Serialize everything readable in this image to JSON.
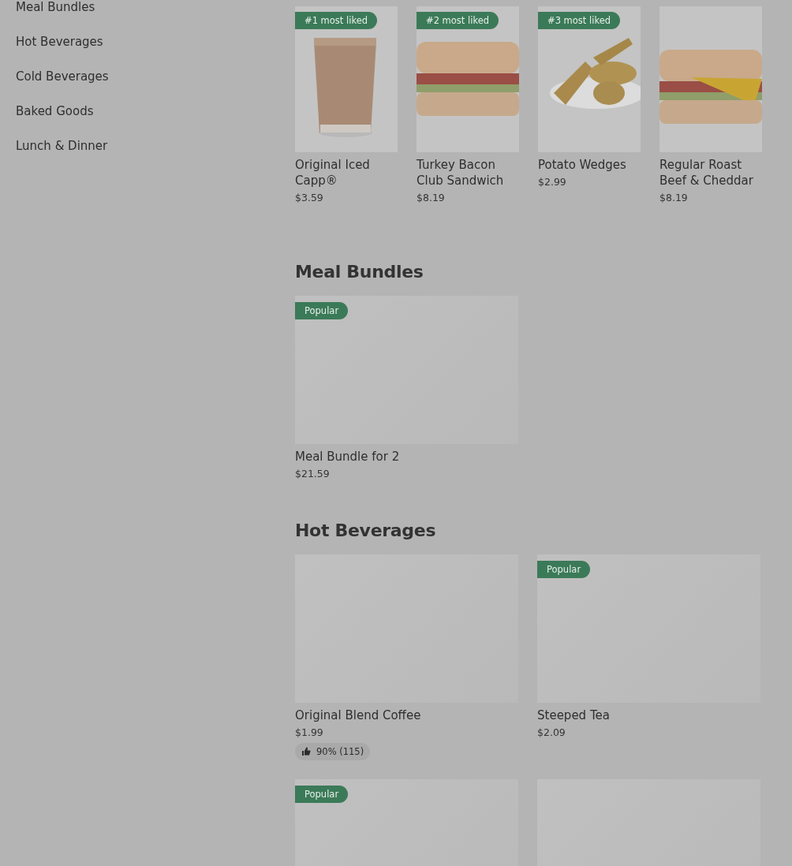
{
  "sidebar": {
    "items": [
      {
        "label": "Meal Bundles"
      },
      {
        "label": "Hot Beverages"
      },
      {
        "label": "Cold Beverages"
      },
      {
        "label": "Baked Goods"
      },
      {
        "label": "Lunch & Dinner"
      }
    ]
  },
  "most_liked": [
    {
      "kind": "picture",
      "badge": "#1 most liked",
      "name": "Original Iced Capp®",
      "price": "$3.59"
    },
    {
      "kind": "picture",
      "badge": "#2 most liked",
      "name": "Turkey Bacon Club Sandwich",
      "price": "$8.19"
    },
    {
      "kind": "picture",
      "badge": "#3 most liked",
      "name": "Potato Wedges",
      "price": "$2.99"
    },
    {
      "kind": "picture",
      "name": "Regular Roast Beef & Cheddar",
      "price": "$8.19"
    }
  ],
  "sections": [
    {
      "title": "Meal Bundles",
      "items": [
        {
          "kind": "placeholder",
          "badge": "Popular",
          "name": "Meal Bundle for 2",
          "price": "$21.59"
        }
      ]
    },
    {
      "title": "Hot Beverages",
      "items": [
        {
          "kind": "placeholder",
          "name": "Original Blend Coffee",
          "price": "$1.99",
          "rating": "90% (115)"
        },
        {
          "kind": "placeholder",
          "badge": "Popular",
          "name": "Steeped Tea",
          "price": "$2.09"
        },
        {
          "kind": "placeholder",
          "badge": "Popular"
        },
        {
          "kind": "placeholder"
        }
      ]
    }
  ]
}
